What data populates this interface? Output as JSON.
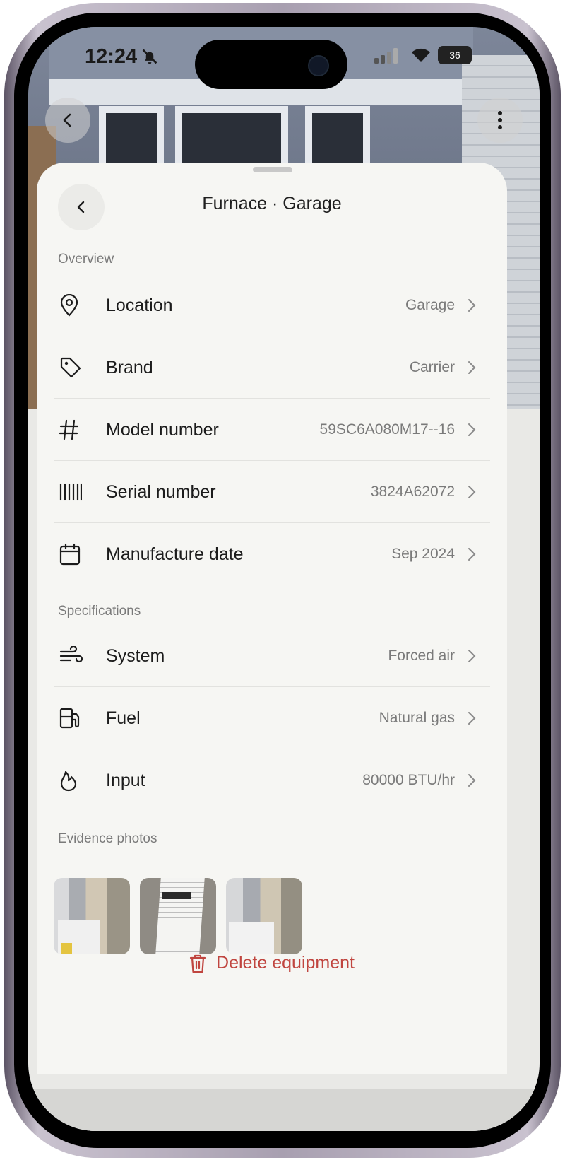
{
  "status_bar": {
    "time": "12:24",
    "battery": "36"
  },
  "sheet": {
    "title": "Furnace · Garage",
    "sections": [
      {
        "label": "Overview",
        "rows": [
          {
            "label": "Location",
            "value": "Garage",
            "icon": "location-pin-icon"
          },
          {
            "label": "Brand",
            "value": "Carrier",
            "icon": "tag-icon"
          },
          {
            "label": "Model number",
            "value": "59SC6A080M17--16",
            "icon": "hash-icon"
          },
          {
            "label": "Serial number",
            "value": "3824A62072",
            "icon": "barcode-icon"
          },
          {
            "label": "Manufacture date",
            "value": "Sep 2024",
            "icon": "calendar-icon"
          }
        ]
      },
      {
        "label": "Specifications",
        "rows": [
          {
            "label": "System",
            "value": "Forced air",
            "icon": "wind-icon"
          },
          {
            "label": "Fuel",
            "value": "Natural gas",
            "icon": "fuel-pump-icon"
          },
          {
            "label": "Input",
            "value": "80000 BTU/hr",
            "icon": "flame-icon"
          }
        ]
      }
    ],
    "photos_label": "Evidence photos",
    "photos": [
      "furnace-photo",
      "label-photo",
      "furnace-photo"
    ],
    "delete_label": "Delete equipment"
  },
  "colors": {
    "sheet_bg": "#f6f6f3",
    "danger": "#c0453f",
    "muted": "#7a7a7a"
  }
}
